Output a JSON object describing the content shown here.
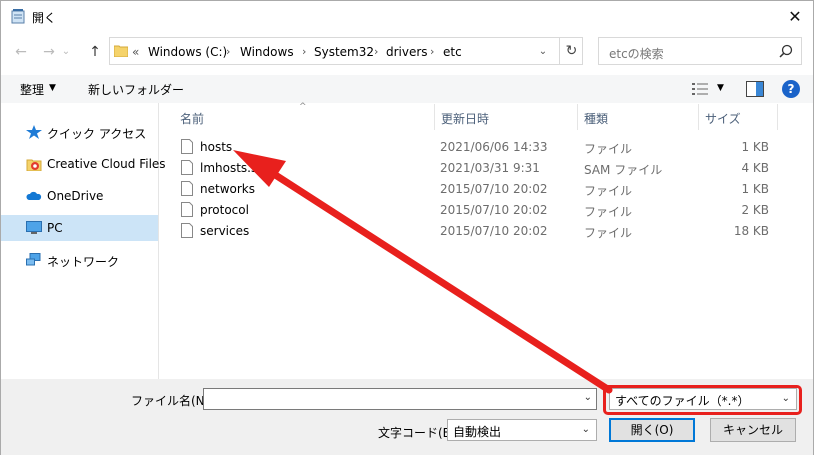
{
  "window": {
    "title": "開く",
    "close_glyph": "✕"
  },
  "nav": {
    "back_glyph": "←",
    "forward_glyph": "→",
    "up_glyph": "↑",
    "dropdown_glyph": "⌄",
    "refresh_glyph": "↻"
  },
  "address": {
    "prefix": "«",
    "crumbs": [
      "Windows (C:)",
      "Windows",
      "System32",
      "drivers",
      "etc"
    ],
    "sep": "›"
  },
  "search": {
    "placeholder": "etcの検索"
  },
  "toolbar": {
    "organize": "整理",
    "organize_arrow": "▼",
    "new_folder": "新しいフォルダー",
    "view_arrow": "▼",
    "help": "?"
  },
  "sidebar": {
    "items": [
      {
        "label": "クイック アクセス",
        "icon": "star-icon"
      },
      {
        "label": "Creative Cloud Files",
        "icon": "creative-cloud-icon"
      },
      {
        "label": "OneDrive",
        "icon": "cloud-icon"
      },
      {
        "label": "PC",
        "icon": "pc-icon"
      },
      {
        "label": "ネットワーク",
        "icon": "network-icon"
      }
    ]
  },
  "columns": {
    "name": "名前",
    "date": "更新日時",
    "type": "種類",
    "size": "サイズ",
    "sort_glyph": "^"
  },
  "files": [
    {
      "name": "hosts",
      "date": "2021/06/06 14:33",
      "type": "ファイル",
      "size": "1 KB"
    },
    {
      "name": "lmhosts.sam",
      "date": "2021/03/31 9:31",
      "type": "SAM ファイル",
      "size": "4 KB"
    },
    {
      "name": "networks",
      "date": "2015/07/10 20:02",
      "type": "ファイル",
      "size": "1 KB"
    },
    {
      "name": "protocol",
      "date": "2015/07/10 20:02",
      "type": "ファイル",
      "size": "2 KB"
    },
    {
      "name": "services",
      "date": "2015/07/10 20:02",
      "type": "ファイル",
      "size": "18 KB"
    }
  ],
  "bottom": {
    "filename_label": "ファイル名(N):",
    "filename_value": "",
    "filetype_value": "すべてのファイル（*.*）",
    "encoding_label": "文字コード(E):",
    "encoding_value": "自動検出",
    "open_button": "開く(O)",
    "cancel_button": "キャンセル",
    "dropdown_glyph": "⌄"
  },
  "colors": {
    "annotation": "#e8201d",
    "selection": "#cce4f7",
    "accent": "#0078d7"
  }
}
